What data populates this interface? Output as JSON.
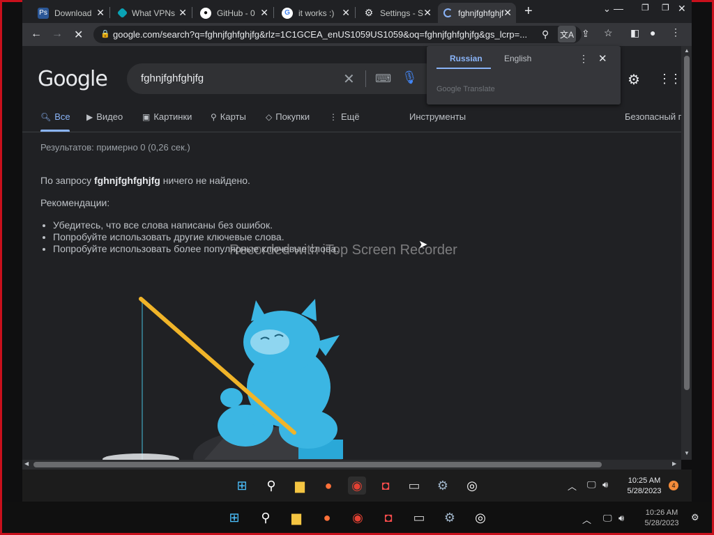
{
  "tabs": [
    {
      "label": "Download",
      "icon": "ps-icon",
      "color": "#2b5797"
    },
    {
      "label": "What VPNs",
      "icon": "vpn-icon",
      "color": "#0aa3b5"
    },
    {
      "label": "GitHub - 0",
      "icon": "github-icon",
      "color": "#24292e"
    },
    {
      "label": "it works :)",
      "icon": "google-icon",
      "color": "#ffffff"
    },
    {
      "label": "Settings - S",
      "icon": "gear-icon",
      "color": "#5f6368"
    },
    {
      "label": "fghnjfghfghjf",
      "icon": "loading-icon",
      "color": "#8ab4f8"
    }
  ],
  "address": {
    "url": "google.com/search?q=fghnjfghfghjfg&rlz=1C1GCEA_enUS1059US1059&oq=fghnjfghfghjfg&gs_lcrp=..."
  },
  "google": {
    "logo": "Google",
    "query": "fghnjfghfghjfg",
    "nav_tabs": [
      "Все",
      "Видео",
      "Картинки",
      "Карты",
      "Покупки",
      "Ещё",
      "Инструменты",
      "Безопасный п"
    ],
    "stats": "Результатов: примерно 0 (0,26 сек.)",
    "no_result_prefix": "По запросу ",
    "no_result_query": "fghnjfghfghjfg",
    "no_result_suffix": " ничего не найдено.",
    "recommendations_title": "Рекомендации:",
    "recommendations": [
      "Убедитесь, что все слова написаны без ошибок.",
      "Попробуйте использовать другие ключевые слова.",
      "Попробуйте использовать более популярные ключевые слова."
    ]
  },
  "translate_popup": {
    "lang_from": "Russian",
    "lang_to": "English",
    "footer": "Google Translate"
  },
  "watermark": "Recorded with iTop Screen Recorder",
  "taskbar_inner": {
    "time": "10:25 AM",
    "date": "5/28/2023",
    "badge": "4"
  },
  "taskbar_outer": {
    "time": "10:26 AM",
    "date": "5/28/2023"
  }
}
